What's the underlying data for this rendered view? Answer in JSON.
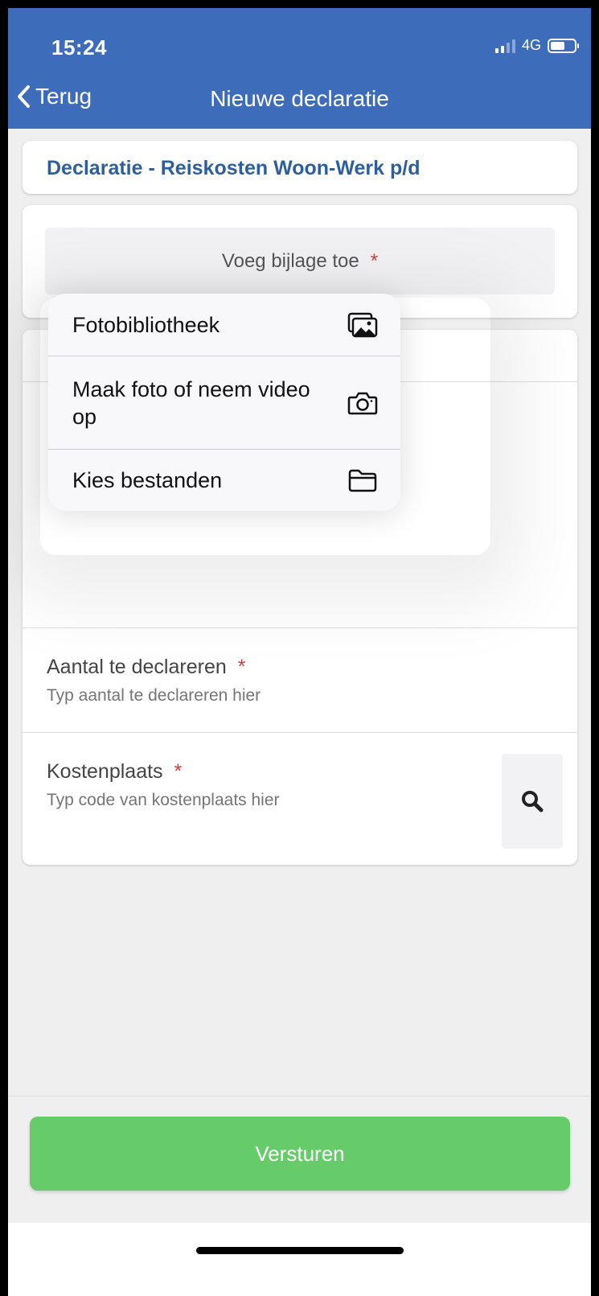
{
  "status_bar": {
    "time": "15:24",
    "network": "4G"
  },
  "nav": {
    "back_label": "Terug",
    "title": "Nieuwe declaratie"
  },
  "declaration_type": "Declaratie - Reiskosten Woon-Werk p/d",
  "attachment": {
    "label": "Voeg bijlage toe",
    "required_mark": "*"
  },
  "attach_menu": {
    "items": [
      {
        "label": "Fotobibliotheek",
        "icon": "photo-library-icon"
      },
      {
        "label": "Maak foto of neem video op",
        "icon": "camera-icon"
      },
      {
        "label": "Kies bestanden",
        "icon": "folder-icon"
      }
    ]
  },
  "fields": {
    "amount": {
      "label": "Aantal te declareren",
      "required_mark": "*",
      "placeholder": "Typ aantal te declareren hier"
    },
    "cost_center": {
      "label": "Kostenplaats",
      "required_mark": "*",
      "placeholder": "Typ code van kostenplaats hier",
      "search_icon": "search-icon"
    }
  },
  "submit": {
    "label": "Versturen"
  },
  "colors": {
    "header": "#3d6cbb",
    "accent_text": "#2d5f9e",
    "required": "#d63a3a",
    "submit": "#66cc6a"
  }
}
